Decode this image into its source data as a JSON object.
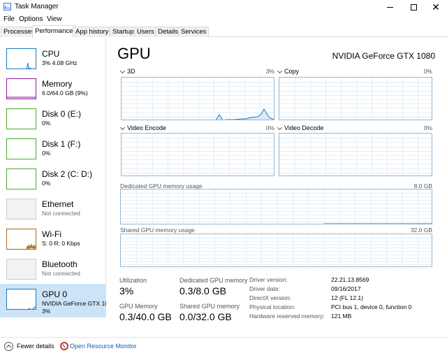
{
  "window": {
    "title": "Task Manager"
  },
  "menu": [
    "File",
    "Options",
    "View"
  ],
  "tabs": [
    "Processes",
    "Performance",
    "App history",
    "Startup",
    "Users",
    "Details",
    "Services"
  ],
  "sidebar": {
    "items": [
      {
        "name": "CPU",
        "sub": "3% 4.08 GHz",
        "sub2": "",
        "color": "#1a7ab8"
      },
      {
        "name": "Memory",
        "sub": "6.0/64.0 GB (9%)",
        "sub2": "",
        "color": "#8b1a9c"
      },
      {
        "name": "Disk 0 (E:)",
        "sub": "0%",
        "sub2": "",
        "color": "#4da82a"
      },
      {
        "name": "Disk 1 (F:)",
        "sub": "0%",
        "sub2": "",
        "color": "#4da82a"
      },
      {
        "name": "Disk 2 (C: D:)",
        "sub": "0%",
        "sub2": "",
        "color": "#4da82a"
      },
      {
        "name": "Ethernet",
        "sub": "Not connected",
        "sub2": "",
        "color": "#c0c0c0"
      },
      {
        "name": "Wi-Fi",
        "sub": "S: 0 R: 0 Kbps",
        "sub2": "",
        "color": "#a8651a"
      },
      {
        "name": "Bluetooth",
        "sub": "Not connected",
        "sub2": "",
        "color": "#c0c0c0"
      },
      {
        "name": "GPU 0",
        "sub": "NVIDIA GeForce GTX 1080",
        "sub2": "3%",
        "color": "#1a7ab8"
      }
    ]
  },
  "gpu": {
    "title": "GPU",
    "model": "NVIDIA GeForce GTX 1080",
    "engines": [
      {
        "label": "3D",
        "pct": "3%"
      },
      {
        "label": "Copy",
        "pct": "0%"
      },
      {
        "label": "Video Encode",
        "pct": "0%"
      },
      {
        "label": "Video Decode",
        "pct": "0%"
      }
    ],
    "dedicated": {
      "label": "Dedicated GPU memory usage",
      "max": "8.0 GB"
    },
    "shared": {
      "label": "Shared GPU memory usage",
      "max": "32.0 GB"
    },
    "stats": {
      "utilization_label": "Utilization",
      "utilization": "3%",
      "dedicated_label": "Dedicated GPU memory",
      "dedicated_value": "0.3/8.0 GB",
      "gpu_memory_label": "GPU Memory",
      "gpu_memory_value": "0.3/40.0 GB",
      "shared_label": "Shared GPU memory",
      "shared_value": "0.0/32.0 GB"
    },
    "details": [
      {
        "key": "Driver version:",
        "value": "22.21.13.8569"
      },
      {
        "key": "Driver date:",
        "value": "09/16/2017"
      },
      {
        "key": "DirectX version:",
        "value": "12 (FL 12.1)"
      },
      {
        "key": "Physical location:",
        "value": "PCI bus 1, device 0, function 0"
      },
      {
        "key": "Hardware reserved memory:",
        "value": "121 MB"
      }
    ]
  },
  "footer": {
    "fewer_details": "Fewer details",
    "open_resource_monitor": "Open Resource Monitor"
  },
  "colors": {
    "graph_border": "#8fb8d8",
    "graph_line": "#1a7ab8",
    "selection": "#cce4f7",
    "link": "#1a5fb4"
  }
}
